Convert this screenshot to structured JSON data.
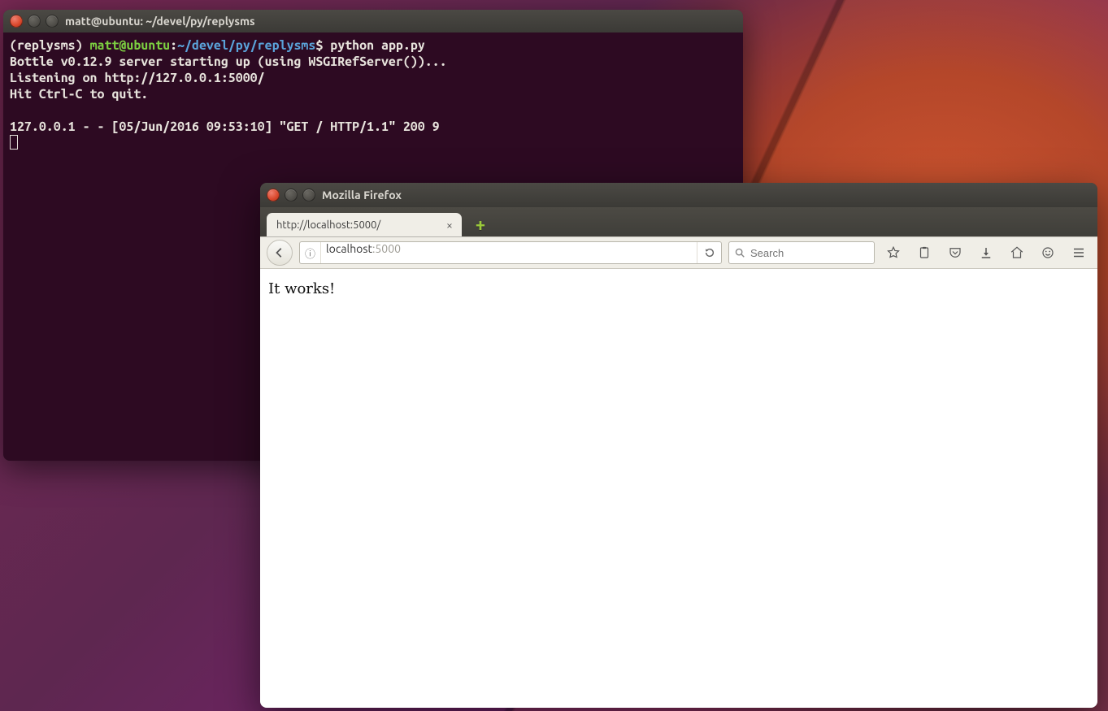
{
  "terminal": {
    "title": "matt@ubuntu: ~/devel/py/replysms",
    "prompt_env": "(replysms) ",
    "prompt_user": "matt@ubuntu",
    "prompt_sep": ":",
    "prompt_path": "~/devel/py/replysms",
    "prompt_dollar": "$ ",
    "command": "python app.py",
    "out_line1": "Bottle v0.12.9 server starting up (using WSGIRefServer())...",
    "out_line2": "Listening on http://127.0.0.1:5000/",
    "out_line3": "Hit Ctrl-C to quit.",
    "out_blank": "",
    "out_line4": "127.0.0.1 - - [05/Jun/2016 09:53:10] \"GET / HTTP/1.1\" 200 9"
  },
  "firefox": {
    "title": "Mozilla Firefox",
    "tab_label": "http://localhost:5000/",
    "url_host": "localhost",
    "url_port": ":5000",
    "search_placeholder": "Search",
    "page_text": "It works!"
  },
  "icons": {
    "close_x": "×",
    "plus": "+",
    "info": "ⓘ"
  }
}
